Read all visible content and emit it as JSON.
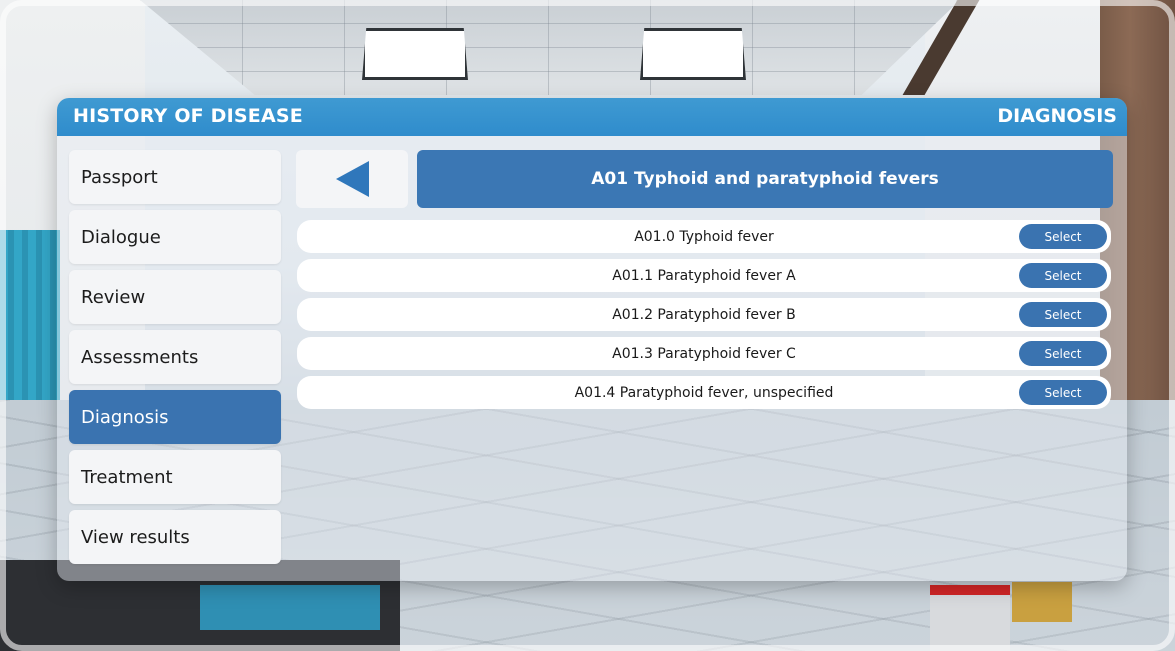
{
  "header": {
    "left_title": "HISTORY OF DISEASE",
    "right_title": "DIAGNOSIS"
  },
  "sidebar": {
    "items": [
      {
        "label": "Passport"
      },
      {
        "label": "Dialogue"
      },
      {
        "label": "Review"
      },
      {
        "label": "Assessments"
      },
      {
        "label": "Diagnosis",
        "active": true
      },
      {
        "label": "Treatment"
      },
      {
        "label": "View results"
      }
    ]
  },
  "main": {
    "back_icon": "left-triangle-icon",
    "category_title": "A01 Typhoid and paratyphoid fevers",
    "diagnoses": [
      {
        "label": "A01.0 Typhoid fever",
        "button": "Select"
      },
      {
        "label": "A01.1 Paratyphoid fever A",
        "button": "Select"
      },
      {
        "label": "A01.2 Paratyphoid fever B",
        "button": "Select"
      },
      {
        "label": "A01.3 Paratyphoid fever C",
        "button": "Select"
      },
      {
        "label": "A01.4 Paratyphoid fever, unspecified",
        "button": "Select"
      }
    ]
  },
  "colors": {
    "titlebar": "#2f8ccc",
    "accent": "#3a73b0",
    "button": "#3a73b0"
  }
}
